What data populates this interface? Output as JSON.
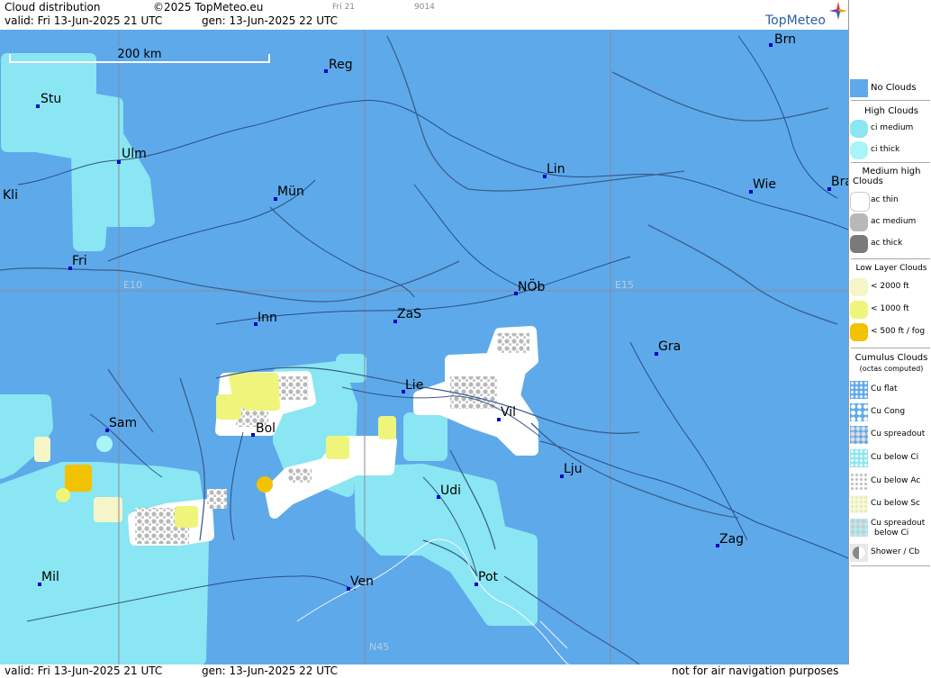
{
  "header": {
    "title": "Cloud distribution",
    "copyright": "©2025 TopMeteo.eu",
    "day_code": "Fri 21",
    "code": "9014",
    "valid": "valid:  Fri  13-Jun-2025  21 UTC",
    "gen": "gen: 13-Jun-2025 22 UTC",
    "logo": "TopMeteo"
  },
  "footer": {
    "valid": "valid:  Fri  13-Jun-2025  21 UTC",
    "gen": "gen: 13-Jun-2025 22 UTC",
    "disclaimer": "not for air navigation purposes"
  },
  "map": {
    "scale_label": "200 km",
    "grid_labels": {
      "e10": "E10",
      "e15": "E15",
      "n45": "N45"
    },
    "cities": {
      "brn": "Brn",
      "reg": "Reg",
      "stu": "Stu",
      "ulm": "Ulm",
      "lin": "Lin",
      "kli": "Kli",
      "mun": "Mün",
      "wie": "Wie",
      "bra": "Bra",
      "fri": "Fri",
      "nob": "NÖb",
      "inn": "Inn",
      "zas": "ZaS",
      "gra": "Gra",
      "lie": "Lie",
      "vil": "Vil",
      "sam": "Sam",
      "bol": "Bol",
      "lju": "Lju",
      "udi": "Udi",
      "zag": "Zag",
      "mil": "Mil",
      "ven": "Ven",
      "pot": "Pot"
    }
  },
  "legend": {
    "no_clouds": "No Clouds",
    "high_title": "High Clouds",
    "ci_medium": "ci medium",
    "ci_thick": "ci thick",
    "medium_title_1": "Medium high",
    "medium_title_2": "Clouds",
    "ac_thin": "ac thin",
    "ac_medium": "ac medium",
    "ac_thick": "ac thick",
    "low_title": "Low Layer Clouds",
    "low_2000": "< 2000 ft",
    "low_1000": "< 1000 ft",
    "low_500": "< 500 ft / fog",
    "cu_title": "Cumulus Clouds",
    "cu_sub": "(octas computed)",
    "cu_flat": "Cu flat",
    "cu_cong": "Cu Cong",
    "cu_spread": "Cu spreadout",
    "cu_below_ci": "Cu below Ci",
    "cu_below_ac": "Cu below Ac",
    "cu_below_sc": "Cu below Sc",
    "cu_spread_ci_1": "Cu spreadout",
    "cu_spread_ci_2": "below Ci",
    "shower": "Shower / Cb"
  },
  "colors": {
    "no_clouds": "#5ea9ea",
    "ci_medium": "#8ae6f2",
    "ci_thick": "#a9f4f9",
    "ac_thin": "#ffffff",
    "ac_medium": "#b8b8b8",
    "ac_thick": "#7a7a7a",
    "low_2000": "#f5f5c8",
    "low_1000": "#eef57a",
    "low_500": "#f2c200",
    "border": "#1f4f8f",
    "city": "#0000cc"
  }
}
